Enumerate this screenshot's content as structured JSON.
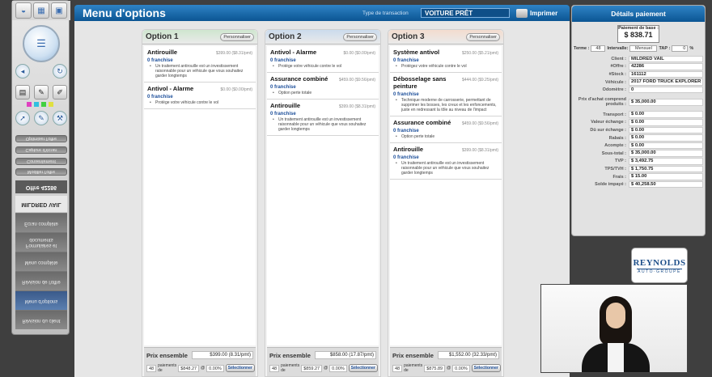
{
  "header": {
    "title": "Menu d'options",
    "transaction_label": "Type de transaction",
    "transaction_value": "VOITURE PRÊT",
    "print_label": "Imprimer"
  },
  "sidebar": {
    "buttons": [
      "Optimiser l'offre",
      "Capture d'écran",
      "Consentement",
      "Modifier l'offre"
    ],
    "offer": "Offre 42286",
    "customer": "MILDRED VAIL",
    "menu": [
      "Écran complète",
      "Formulaires et documents",
      "Menu complète",
      "Révision de l'offre",
      "Menu d'options",
      "Révision du client"
    ]
  },
  "options": [
    {
      "title": "Option 1",
      "customize": "Personnaliser",
      "items": [
        {
          "name": "Antirouille",
          "price": "$399.00 ($8.31/pmt)",
          "franchise": "0 franchise",
          "desc": "Un traitement antirouille est un investissement raisonnable pour un véhicule que vous souhaitez garder longtemps"
        },
        {
          "name": "Antivol - Alarme",
          "price": "$0.00 ($0.00/pmt)",
          "franchise": "0 franchise",
          "desc": "Protège votre véhicule contre le vol"
        }
      ],
      "total_label": "Prix ensemble",
      "total": "$399.00 (8.31/pmt)",
      "term": "48",
      "pay_label": "paiements de",
      "payment": "$848.27",
      "rate_prefix": "@",
      "rate": "0.00%",
      "select": "Sélectionner"
    },
    {
      "title": "Option 2",
      "customize": "Personnaliser",
      "items": [
        {
          "name": "Antivol - Alarme",
          "price": "$0.00 ($0.00/pmt)",
          "franchise": "0 franchise",
          "desc": "Protège votre véhicule contre le vol"
        },
        {
          "name": "Assurance combiné",
          "price": "$459.00 ($9.56/pmt)",
          "franchise": "0 franchise",
          "desc": "Option perte totale"
        },
        {
          "name": "Antirouille",
          "price": "$399.00 ($8.31/pmt)",
          "franchise": "0 franchise",
          "desc": "Un traitement antirouille est un investissement raisonnable pour un véhicule que vous souhaitez garder longtemps"
        }
      ],
      "total_label": "Prix ensemble",
      "total": "$858.00 (17.87/pmt)",
      "term": "48",
      "pay_label": "paiements de",
      "payment": "$859.27",
      "rate_prefix": "@",
      "rate": "0.00%",
      "select": "Sélectionner"
    },
    {
      "title": "Option 3",
      "customize": "Personnaliser",
      "items": [
        {
          "name": "Système antivol",
          "price": "$250.00 ($5.21/pmt)",
          "franchise": "0 franchise",
          "desc": "Protégez votre véhicule contre le vol"
        },
        {
          "name": "Débosselage sans peinture",
          "price": "$444.00 ($9.25/pmt)",
          "franchise": "0 franchise",
          "desc": "Technique moderne de carrosserie, permettant de supprimer les bosses, les creux et les enfoncements, juste en redressant la tôle au niveau de l'impact"
        },
        {
          "name": "Assurance combiné",
          "price": "$459.00 ($9.56/pmt)",
          "franchise": "0 franchise",
          "desc": "Option perte totale"
        },
        {
          "name": "Antirouille",
          "price": "$399.00 ($8.31/pmt)",
          "franchise": "0 franchise",
          "desc": "Un traitement antirouille est un investissement raisonnable pour un véhicule que vous souhaitez garder longtemps"
        }
      ],
      "total_label": "Prix ensemble",
      "total": "$1,552.00 (32.33/pmt)",
      "term": "48",
      "pay_label": "paiements de",
      "payment": "$875.89",
      "rate_prefix": "@",
      "rate": "0.00%",
      "select": "Sélectionner"
    }
  ],
  "details": {
    "title": "Détails paiement",
    "base_label": "Paiement de base :",
    "base_value": "$ 838.71",
    "term_label": "Terme :",
    "term_value": "48",
    "interval_label": "Intervalle:",
    "interval_value": "Mensuel",
    "tap_label": "TAP :",
    "tap_value": "0",
    "tap_unit": "%",
    "rows": [
      {
        "label": "Client :",
        "value": "MILDRED  VAIL"
      },
      {
        "label": "#Offre :",
        "value": "42286"
      },
      {
        "label": "#Stock :",
        "value": "161112"
      },
      {
        "label": "Véhicule :",
        "value": "2017 FORD TRUCK EXPLORER"
      },
      {
        "label": "Odomètre :",
        "value": "0"
      },
      {
        "label": "Prix d'achat comprend produits :",
        "value": "$ 35,000.00"
      },
      {
        "label": "Transport :",
        "value": "$ 0.00"
      },
      {
        "label": "Valeur échange :",
        "value": "$ 0.00"
      },
      {
        "label": "Dû sur échange :",
        "value": "$ 0.00"
      },
      {
        "label": "Rabais :",
        "value": "$ 0.00"
      },
      {
        "label": "Acompte :",
        "value": "$ 0.00"
      },
      {
        "label": "Sous-total :",
        "value": "$ 35,000.00"
      },
      {
        "label": "TVP :",
        "value": "$ 3,492.75"
      },
      {
        "label": "TPS/TVH :",
        "value": "$ 1,750.75"
      },
      {
        "label": "Frais :",
        "value": "$ 15.00"
      },
      {
        "label": "Solde impayé :",
        "value": "$ 40,258.50"
      }
    ]
  },
  "logo": {
    "name": "REYNOLDS",
    "tagline": "AUTO·GROUPE"
  },
  "colors": {
    "header": "#0b5593",
    "option1": "#cfe6cf",
    "option2": "#cbdbed",
    "option3": "#f3dccf"
  }
}
